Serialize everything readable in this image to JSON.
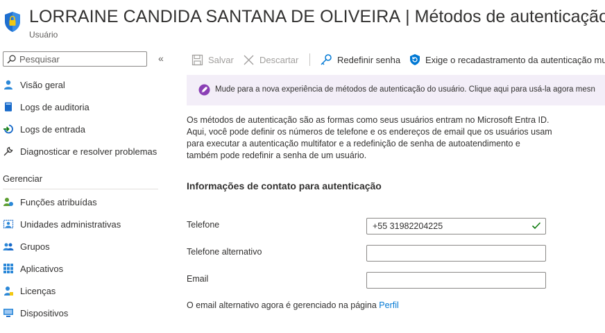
{
  "header": {
    "user_name": "LORRAINE CANDIDA SANTANA DE OLIVEIRA",
    "separator": "|",
    "page_name": "Métodos de autenticação",
    "subtitle": "Usuário",
    "more_icon": "ellipsis-icon"
  },
  "sidebar": {
    "search_placeholder": "Pesquisar",
    "collapse_glyph": "«",
    "items": [
      {
        "label": "Visão geral",
        "icon": "person-icon"
      },
      {
        "label": "Logs de auditoria",
        "icon": "book-icon"
      },
      {
        "label": "Logs de entrada",
        "icon": "sign-in-icon"
      },
      {
        "label": "Diagnosticar e resolver problemas",
        "icon": "wrench-icon"
      }
    ],
    "section_title": "Gerenciar",
    "manage_items": [
      {
        "label": "Funções atribuídas",
        "icon": "roles-icon"
      },
      {
        "label": "Unidades administrativas",
        "icon": "admin-units-icon"
      },
      {
        "label": "Grupos",
        "icon": "groups-icon"
      },
      {
        "label": "Aplicativos",
        "icon": "apps-grid-icon"
      },
      {
        "label": "Licenças",
        "icon": "license-icon"
      },
      {
        "label": "Dispositivos",
        "icon": "device-icon"
      }
    ]
  },
  "toolbar": {
    "save_label": "Salvar",
    "discard_label": "Descartar",
    "reset_password_label": "Redefinir senha",
    "require_reregister_label": "Exige o recadastramento da autenticação mu"
  },
  "banner": {
    "text": "Mude para a nova experiência de métodos de autenticação do usuário. Clique aqui para usá-la agora mesn"
  },
  "main": {
    "description": "Os métodos de autenticação são as formas como seus usuários entram no Microsoft Entra ID. Aqui, você pode definir os números de telefone e os endereços de email que os usuários usam para executar a autenticação multifator e a redefinição de senha de autoatendimento e também pode redefinir a senha de um usuário.",
    "section_heading": "Informações de contato para autenticação",
    "fields": [
      {
        "label": "Telefone",
        "value": "+55 31982204225"
      },
      {
        "label": "Telefone alternativo",
        "value": ""
      },
      {
        "label": "Email",
        "value": ""
      }
    ],
    "footer_prefix": "O email alternativo agora é gerenciado na página",
    "footer_link": "Perfil"
  },
  "colors": {
    "accent": "#0078d4",
    "banner_bg": "#f3eef8",
    "check": "#107c10"
  }
}
